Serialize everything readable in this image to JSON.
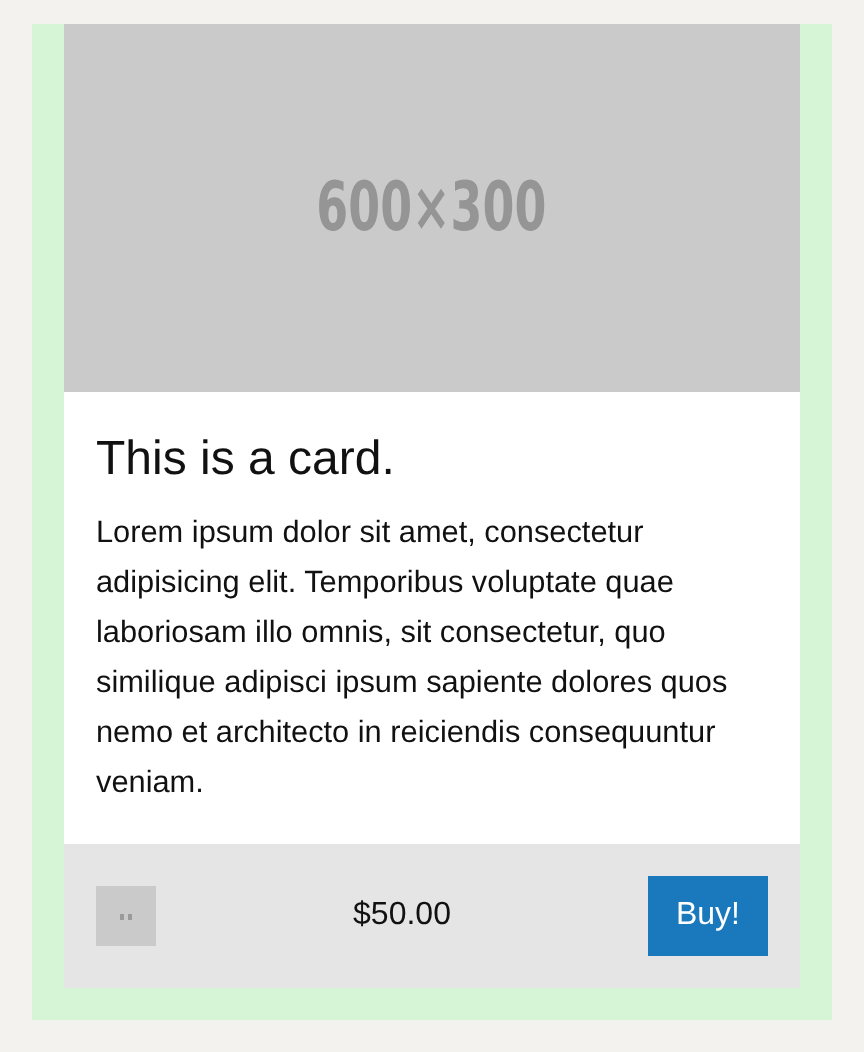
{
  "card": {
    "image": {
      "kind": "placeholder",
      "label": "600×300"
    },
    "title": "This is a card.",
    "text": "Lorem ipsum dolor sit amet, consectetur adipisicing elit. Temporibus voluptate quae laboriosam illo omnis, sit consectetur, quo similique adipisci ipsum sapiente dolores quos nemo et architecto in reiciendis consequuntur veniam.",
    "footer": {
      "price": "$50.00",
      "button": "Buy!"
    }
  }
}
